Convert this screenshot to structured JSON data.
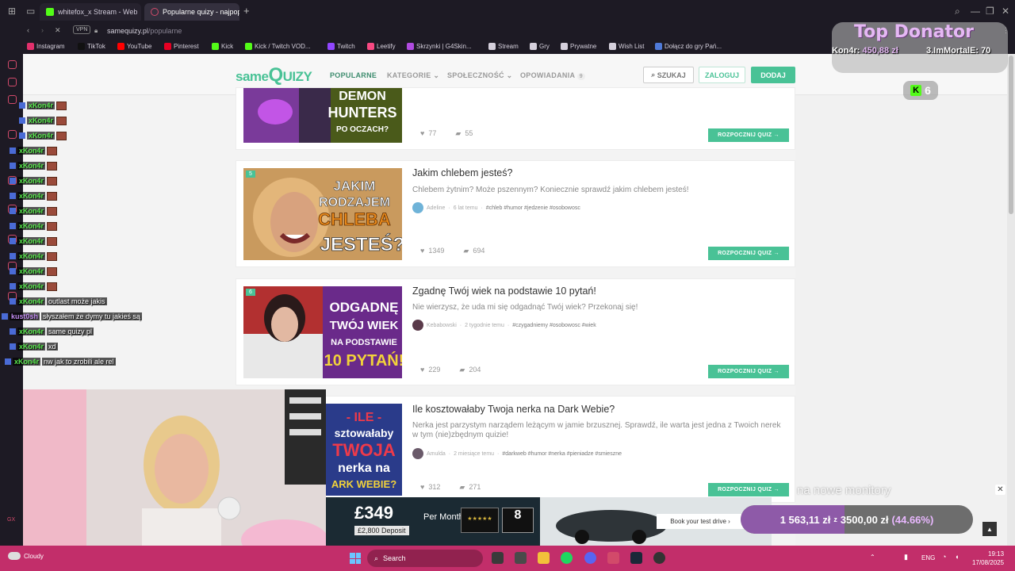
{
  "browser": {
    "tabs": [
      {
        "label": "whitefox_x Stream - Web",
        "active": false
      },
      {
        "label": "Popularne quizy - najpop",
        "active": true
      }
    ],
    "vpn_label": "VPN",
    "url_domain": "samequizy.pl",
    "url_path": "/popularne",
    "bookmarks": [
      {
        "label": "Instagram",
        "color": "#e1306c"
      },
      {
        "label": "TikTok",
        "color": "#111111"
      },
      {
        "label": "YouTube",
        "color": "#ff0000"
      },
      {
        "label": "Pinterest",
        "color": "#e60023"
      },
      {
        "label": "Kick",
        "color": "#53fc18"
      },
      {
        "label": "Kick / Twitch VOD...",
        "color": "#53fc18"
      },
      {
        "label": "Twitch",
        "color": "#9146ff"
      },
      {
        "label": "Leetify",
        "color": "#f84982"
      },
      {
        "label": "Skrzynki | G4Skin...",
        "color": "#b04be0"
      },
      {
        "label": "Stream",
        "color": "#d5d0dc"
      },
      {
        "label": "Gry",
        "color": "#d5d0dc"
      },
      {
        "label": "Prywatne",
        "color": "#d5d0dc"
      },
      {
        "label": "Wish List",
        "color": "#d5d0dc"
      },
      {
        "label": "Dołącz do gry Pań...",
        "color": "#4f7ad8"
      }
    ]
  },
  "site": {
    "logo_same": "same",
    "logo_q": "Q",
    "logo_uizy": "UIZY",
    "nav": {
      "popular": "POPULARNE",
      "categories": "KATEGORIE ⌄",
      "community": "SPOŁECZNOŚĆ ⌄",
      "stories": "OPOWIADANIA",
      "stories_badge": "9"
    },
    "search_label": "SZUKAJ",
    "login_label": "ZALOGUJ",
    "add_label": "DODAJ"
  },
  "quizzes": [
    {
      "rank": "",
      "title": "",
      "description": "",
      "author": "",
      "time": "",
      "tags": "",
      "likes": "77",
      "comments": "55",
      "start_label": "ROZPOCZNIJ QUIZ →",
      "thumb_text": [
        "DEMON",
        "HUNTERS",
        "PO OCZACH?"
      ]
    },
    {
      "rank": "5",
      "title": "Jakim chlebem jesteś?",
      "description": "Chlebem żytnim? Może pszennym? Koniecznie sprawdź jakim chlebem jesteś!",
      "author": "Adeline",
      "time": "6 lat temu",
      "tags": "#chleb #humor #jedzenie #osobowosc",
      "likes": "1349",
      "comments": "694",
      "start_label": "ROZPOCZNIJ QUIZ →",
      "thumb_text": [
        "JAKIM",
        "RODZAJEM",
        "CHLEBA",
        "JESTEŚ?"
      ]
    },
    {
      "rank": "6",
      "title": "Zgadnę Twój wiek na podstawie 10 pytań!",
      "description": "Nie wierzysz, że uda mi się odgadnąć Twój wiek? Przekonaj się!",
      "author": "Kebabowski",
      "time": "2 tygodnie temu",
      "tags": "#czygadniemy #osobowosc #wiek",
      "likes": "229",
      "comments": "204",
      "start_label": "ROZPOCZNIJ QUIZ →",
      "thumb_text": [
        "ODGADNĘ",
        "TWÓJ WIEK",
        "NA PODSTAWIE",
        "10 PYTAŃ!"
      ]
    },
    {
      "rank": "",
      "title": "Ile kosztowałaby Twoja nerka na Dark Webie?",
      "description": "Nerka jest parzystym narządem leżącym w jamie brzusznej. Sprawdź, ile warta jest jedna z Twoich nerek w tym (nie)zbędnym quizie!",
      "author": "Amulda",
      "time": "2 miesiące temu",
      "tags": "#darkweb #humor #nerka #pieniadze #smieszne",
      "likes": "312",
      "comments": "271",
      "start_label": "ROZPOCZNIJ QUIZ →",
      "thumb_text": [
        "- ILE -",
        "sztowałaby",
        "TWOJA",
        "nerka na",
        "ARK WEBIE?"
      ]
    }
  ],
  "overlay": {
    "top_donator_title": "Top Donator",
    "first_donor": "Kon4r:",
    "first_amount": "450,88 zł",
    "third_donor": "3.ImMortalE: 70",
    "kick_viewers": "6",
    "chat": [
      {
        "user": "xKon4r",
        "text": ""
      },
      {
        "user": "xKon4r",
        "text": ""
      },
      {
        "user": "xKon4r",
        "text": ""
      },
      {
        "user": "xKon4r",
        "text": ""
      },
      {
        "user": "xKon4r",
        "text": ""
      },
      {
        "user": "xKon4r",
        "text": ""
      },
      {
        "user": "xKon4r",
        "text": ""
      },
      {
        "user": "xKon4r",
        "text": ""
      },
      {
        "user": "xKon4r",
        "text": ""
      },
      {
        "user": "xKon4r",
        "text": ""
      },
      {
        "user": "xKon4r",
        "text": ""
      },
      {
        "user": "xKon4r",
        "text": ""
      },
      {
        "user": "xKon4r",
        "text": ""
      },
      {
        "user": "xKon4r",
        "text": "outlast może jakis"
      },
      {
        "user": "kust0sh",
        "text": "słyszałem że dymy tu jakieś są"
      },
      {
        "user": "xKon4r",
        "text": "same quizy pl"
      },
      {
        "user": "xKon4r",
        "text": "xd"
      },
      {
        "user": "xKon4r",
        "text": "nw jak to zrobili ale rel"
      }
    ],
    "goal_caption": "na nowe monitory",
    "goal_current": "1 563,11 zł",
    "goal_of": "z",
    "goal_target": "3500,00 zł",
    "goal_percent": "(44.66%)",
    "goal_fraction": 0.4466
  },
  "ad": {
    "price": "£349",
    "per_month": "Per Month",
    "deposit": "£2,800 Deposit",
    "stars": "★★★★★",
    "warranty": "8",
    "cta": "Book your test drive ›"
  },
  "taskbar": {
    "weather": "Cloudy",
    "search_label": "Search",
    "lang": "ENG",
    "time": "19:13",
    "date": "17/08/2025"
  }
}
